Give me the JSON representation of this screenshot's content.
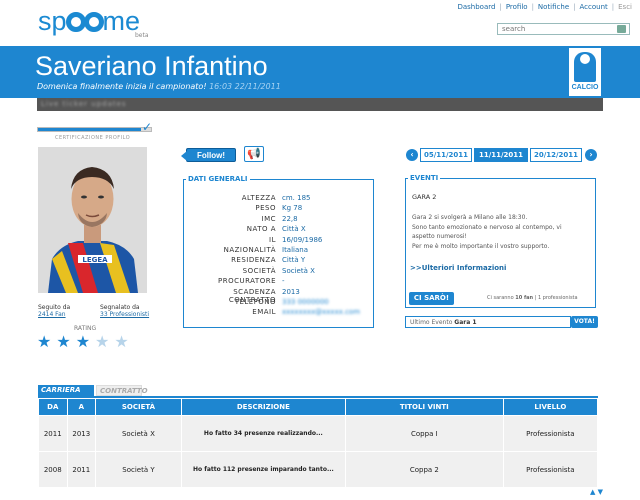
{
  "header": {
    "logo": "spoome",
    "beta": "beta",
    "nav": [
      "Dashboard",
      "Profilo",
      "Notifiche",
      "Account",
      "Esci"
    ],
    "search_placeholder": "search"
  },
  "profile": {
    "name": "Saveriano Infantino",
    "tagline": "Domenica finalmente inizia il campionato!",
    "timestamp": "16:03 22/11/2011",
    "sport": "CALCIO",
    "ticker": "Live ticker updates",
    "cert_label": "CERTIFICAZIONE PROFILO",
    "cert_progress": 0.91,
    "jersey_text": "LEGEA"
  },
  "stats": {
    "seguito_label": "Seguito da",
    "seguito_value": "2414 Fan",
    "segnalato_label": "Segnalato da",
    "segnalato_value": "33 Professionisti",
    "rating_label": "RATING",
    "rating_value": 3,
    "rating_max": 5,
    "colors": {
      "star_on": "#1e86d0",
      "star_off": "#b7d4ea"
    }
  },
  "actions": {
    "follow": "Follow!",
    "megaphone_icon": "megaphone-icon"
  },
  "dates": {
    "prev": "05/11/2011",
    "current": "11/11/2011",
    "next": "20/12/2011"
  },
  "dati": {
    "title": "DATI GENERALI",
    "rows": [
      {
        "k": "ALTEZZA",
        "v": "cm. 185"
      },
      {
        "k": "PESO",
        "v": "Kg 78"
      },
      {
        "k": "IMC",
        "v": "22,8"
      },
      {
        "k": "NATO A",
        "v": "Città X"
      },
      {
        "k": "IL",
        "v": "16/09/1986"
      },
      {
        "k": "NAZIONALITÀ",
        "v": "Italiana"
      },
      {
        "k": "RESIDENZA",
        "v": "Città Y"
      },
      {
        "k": "SOCIETÀ",
        "v": "Società X"
      },
      {
        "k": "PROCURATORE",
        "v": "-"
      },
      {
        "k": "SCADENZA CONTRATTO",
        "v": "2013"
      },
      {
        "k": "TELEFONO",
        "v": "333 0000000"
      },
      {
        "k": "EMAIL",
        "v": "xxxxxxxx@xxxxx.com"
      }
    ]
  },
  "eventi": {
    "title": "EVENTI",
    "event_name": "GARA 2",
    "line1": "Gara 2 si svolgerà a Milano alle 18:30.",
    "line2": "Sono tanto emozionato e nervoso al contempo, vi",
    "line3": "aspetto numerosi!",
    "line4": "Per me è molto importante il vostro supporto.",
    "link": ">>Ulteriori Informazioni",
    "ci_saro": "CI SARÒ!",
    "fan_note_prefix": "Ci saranno",
    "fan_count": "10 fan",
    "fan_sep": "|",
    "pro_count": "1 professionista",
    "ultimo_label": "Ultimo Evento",
    "ultimo_value": "Gara 1",
    "vota": "VOTA!"
  },
  "career": {
    "tab_active": "CARRIERA",
    "tab_inactive": "CONTRATTO",
    "headers": [
      "DA",
      "A",
      "SOCIETÀ",
      "DESCRIZIONE",
      "TITOLI VINTI",
      "LIVELLO"
    ],
    "rows": [
      [
        "2011",
        "2013",
        "Società X",
        "Ho fatto 34 presenze realizzando...",
        "Coppa I",
        "Professionista"
      ],
      [
        "2008",
        "2011",
        "Società Y",
        "Ho fatto 112 presenze imparando tanto...",
        "Coppa 2",
        "Professionista"
      ]
    ],
    "scroll_up": "▲",
    "scroll_down": "▼"
  }
}
